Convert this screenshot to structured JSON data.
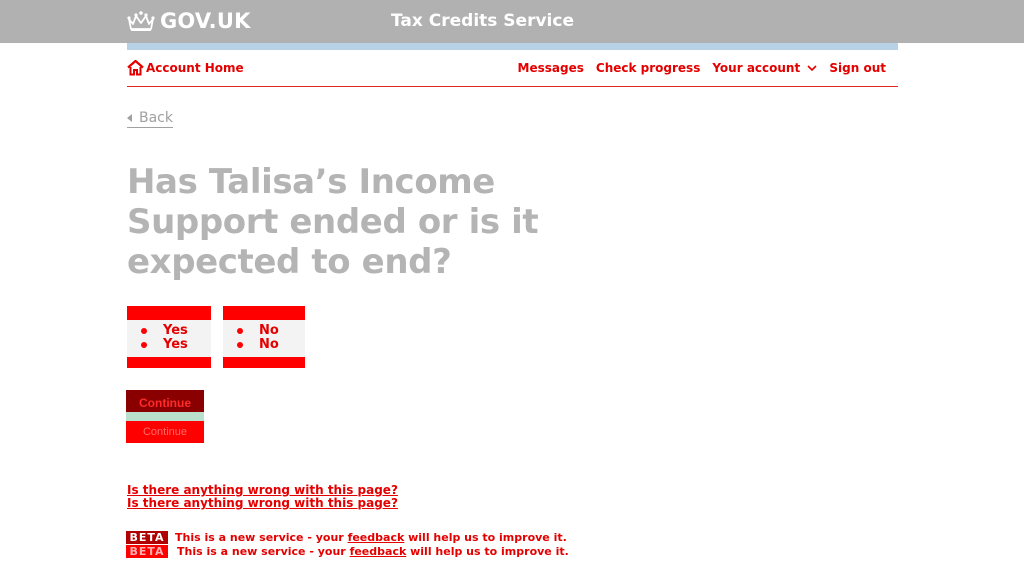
{
  "header": {
    "logo_text": "GOV.UK",
    "service_name": "Tax Credits Service",
    "logo_icon": "crown-icon"
  },
  "nav": {
    "home_label": "Account Home",
    "home_icon": "home-icon",
    "messages_label": "Messages",
    "check_progress_label": "Check progress",
    "your_account_label": "Your account",
    "sign_out_label": "Sign out"
  },
  "back": {
    "label": "Back"
  },
  "question": {
    "heading": "Has Talisa’s Income Support ended or is it expected to end?"
  },
  "options": [
    {
      "label": "Yes"
    },
    {
      "label": "No"
    }
  ],
  "continue": {
    "label": "Continue"
  },
  "report": {
    "label": "Is there anything wrong with this page?"
  },
  "beta": {
    "tag": "BETA",
    "text_before": "This is a new service - your ",
    "feedback_link": "feedback",
    "text_after": " will help us to improve it."
  },
  "colors": {
    "header_bg": "#b1b1b1",
    "phase_bar": "#b7d1e6",
    "link_red": "#e50000",
    "heading_grey": "#b4b4b4"
  }
}
